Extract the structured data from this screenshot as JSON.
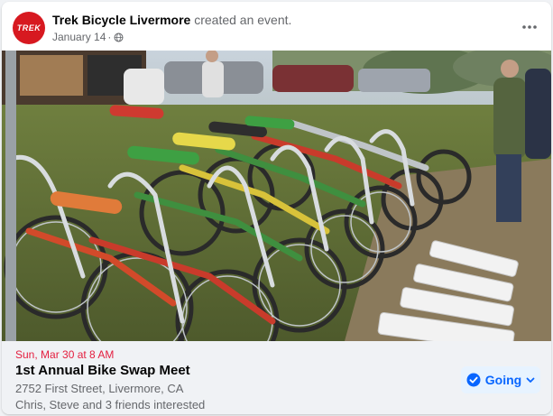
{
  "post": {
    "page_name": "Trek Bicycle Livermore",
    "action_text": "created an event.",
    "date": "January 14",
    "separator": "·",
    "privacy_icon": "globe-icon",
    "avatar_logo_text": "TREK",
    "more_icon": "more-dots-icon"
  },
  "event": {
    "date_time": "Sun, Mar 30 at 8 AM",
    "title": "1st Annual Bike Swap Meet",
    "address": "2752 First Street, Livermore, CA",
    "interest": "Chris, Steve and 3 friends interested",
    "rsvp_label": "Going",
    "rsvp_icon": "check-circle-icon",
    "rsvp_dropdown_icon": "chevron-down-icon"
  },
  "colors": {
    "brand_red": "#d71920",
    "date_red": "#e41e3f",
    "accent_blue": "#0866ff",
    "going_bg": "#e7f3ff",
    "footer_bg": "#f0f2f5"
  }
}
